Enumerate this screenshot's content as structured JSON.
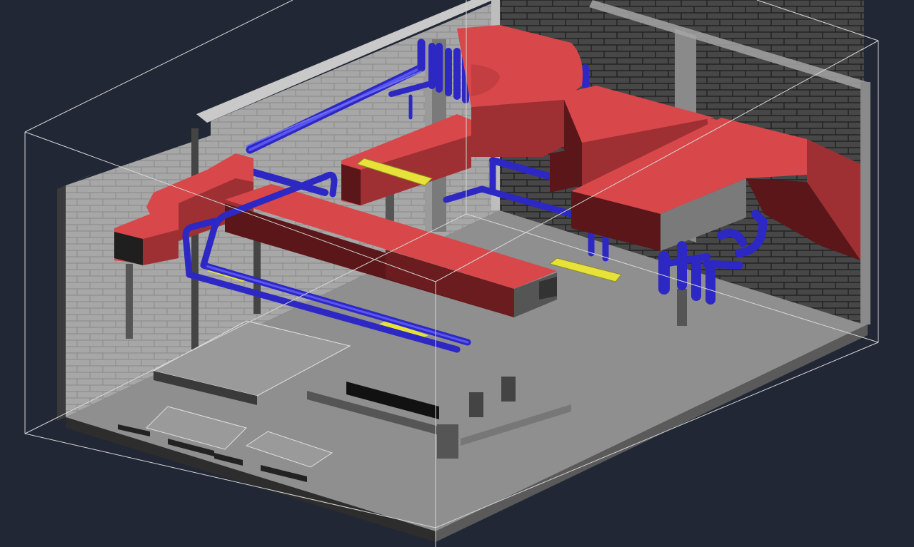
{
  "viewport": {
    "background": "#212735",
    "description_visible_text": ""
  },
  "colors": {
    "duct_top": "#d8474a",
    "duct_side": "#9e3034",
    "duct_dark": "#5a1618",
    "duct_end": "#3a3a3a",
    "pipe": "#3a33d6",
    "pipe_light": "#5a56f0",
    "insulation": "#e6e23a",
    "floor": "#8e8e8e",
    "floor_edge": "#6a6a6a",
    "wall_light": "#a9a9a9",
    "wall_dark": "#4a4a4a",
    "brick_line": "#2a2a2a",
    "wireframe": "#d8d8d8"
  },
  "icons": {
    "model": "isometric-hvac-room-model"
  }
}
